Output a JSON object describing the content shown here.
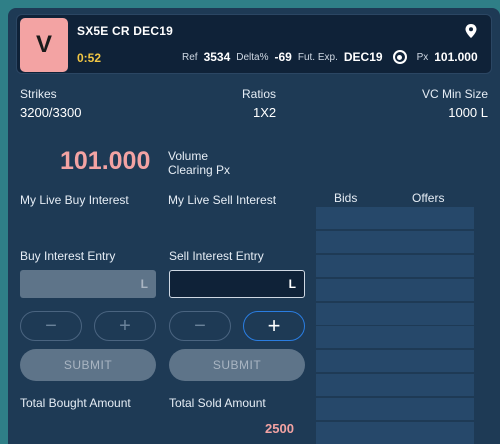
{
  "header": {
    "badge": "V",
    "title": "SX5E  CR DEC19",
    "timer": "0:52",
    "ref_label": "Ref",
    "ref_value": "3534",
    "delta_label": "Delta%",
    "delta_value": "-69",
    "fut_label": "Fut. Exp.",
    "fut_value": "DEC19",
    "px_label": "Px",
    "px_value": "101.000"
  },
  "info": {
    "strikes_label": "Strikes",
    "strikes_value": "3200/3300",
    "ratios_label": "Ratios",
    "ratios_value": "1X2",
    "vcmin_label": "VC Min Size",
    "vcmin_value": "1000 L"
  },
  "price": {
    "value": "101.000",
    "caption_line1": "Volume",
    "caption_line2": "Clearing Px"
  },
  "interest": {
    "buy_label": "My Live Buy Interest",
    "sell_label": "My Live Sell Interest"
  },
  "book": {
    "bids_label": "Bids",
    "offers_label": "Offers"
  },
  "entry": {
    "buy_label": "Buy Interest Entry",
    "sell_label": "Sell Interest Entry",
    "buy_suffix": "L",
    "sell_suffix": "L"
  },
  "steppers": {
    "minus": "−",
    "plus": "+"
  },
  "buttons": {
    "buy_submit": "SUBMIT",
    "sell_submit": "SUBMIT"
  },
  "totals": {
    "bought_label": "Total Bought Amount",
    "sold_label": "Total Sold Amount",
    "sold_value": "2500"
  },
  "colors": {
    "accent_pink": "#f3a3a3",
    "timer_yellow": "#f2c744",
    "panel_bg": "#1e3a55",
    "active_blue": "#2a7de1"
  }
}
